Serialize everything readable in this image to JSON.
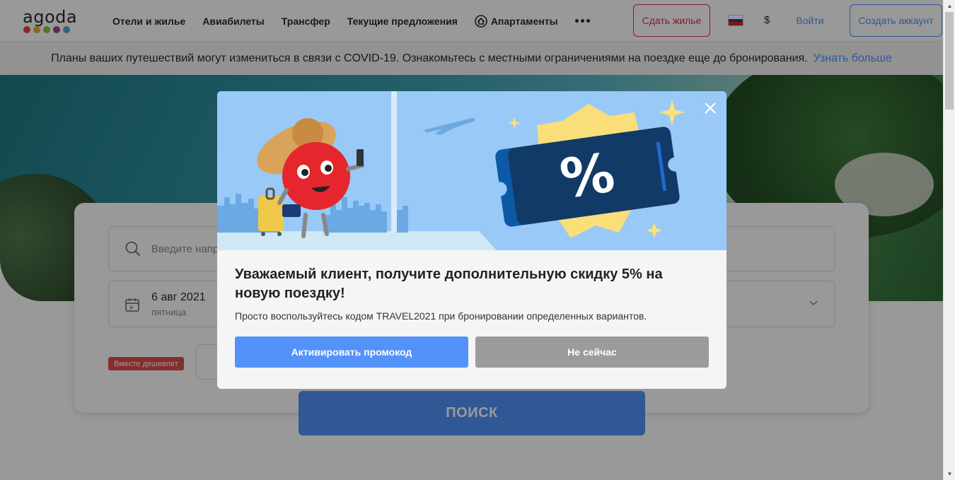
{
  "header": {
    "logo_text": "agoda",
    "nav": [
      "Отели и жилье",
      "Авиабилеты",
      "Трансфер",
      "Текущие предложения"
    ],
    "nav_apartments": "Апартаменты",
    "host_button": "Сдать жилье",
    "currency": "$",
    "login": "Войти",
    "signup": "Создать аккаунт"
  },
  "banner": {
    "text": "Планы ваших путешествий могут измениться в связи с COVID-19. Ознакомьтесь с местными ограничениями на поездке еще до бронирования.",
    "link": "Узнать больше"
  },
  "search": {
    "destination_placeholder": "Введите напр",
    "date_main": "6 авг 2021",
    "date_sub": "пятница",
    "cheaper_badge": "Вместе дешевлет",
    "search_button": "ПОИСК"
  },
  "modal": {
    "title": "Уважаемый клиент, получите дополнительную скидку 5% на новую поездку!",
    "text": "Просто воспользуйтесь кодом TRAVEL2021 при бронировании определенных вариантов.",
    "activate_button": "Активировать промокод",
    "later_button": "Не сейчас",
    "ticket_symbol": "%"
  },
  "colors": {
    "accent": "#5392f9",
    "host_red": "#e12d48",
    "badge_red": "#e04b4b",
    "modal_sky": "#99c9f7"
  }
}
